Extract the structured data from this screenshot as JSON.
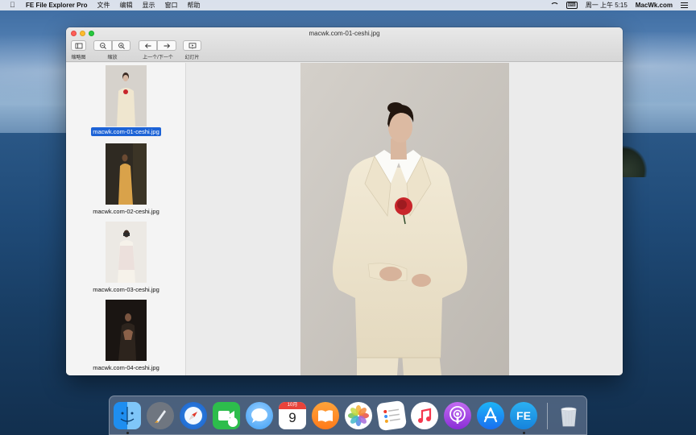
{
  "menubar": {
    "app_name": "FE File Explorer Pro",
    "menus": [
      "文件",
      "编辑",
      "显示",
      "窗口",
      "帮助"
    ],
    "clock": "周一 上午 5:15",
    "brand": "MacWk.com",
    "input_method": "⌨"
  },
  "window": {
    "title": "macwk.com-01-ceshi.jpg",
    "toolbar": {
      "thumbnails_label": "缩略图",
      "zoom_label": "缩放",
      "prevnext_label": "上一个/下一个",
      "slideshow_label": "幻灯片"
    }
  },
  "sidebar": {
    "items": [
      {
        "label": "macwk.com-01-ceshi.jpg",
        "selected": true
      },
      {
        "label": "macwk.com-02-ceshi.jpg",
        "selected": false
      },
      {
        "label": "macwk.com-03-ceshi.jpg",
        "selected": false
      },
      {
        "label": "macwk.com-04-ceshi.jpg",
        "selected": false
      }
    ]
  },
  "dock": {
    "apps": [
      "finder-icon",
      "launchpad-icon",
      "safari-icon",
      "facetime-icon",
      "messages-icon",
      "calendar-icon",
      "books-icon",
      "photos-icon",
      "reminders-icon",
      "music-icon",
      "podcasts-icon",
      "app-store-icon",
      "fe-file-explorer-icon",
      "trash-icon"
    ],
    "calendar": {
      "month": "10月",
      "day": "9"
    },
    "fe_label": "FE"
  },
  "colors": {
    "selection": "#1d63d6",
    "accent_red": "#c8262b",
    "suit_cream": "#efe6cf"
  }
}
